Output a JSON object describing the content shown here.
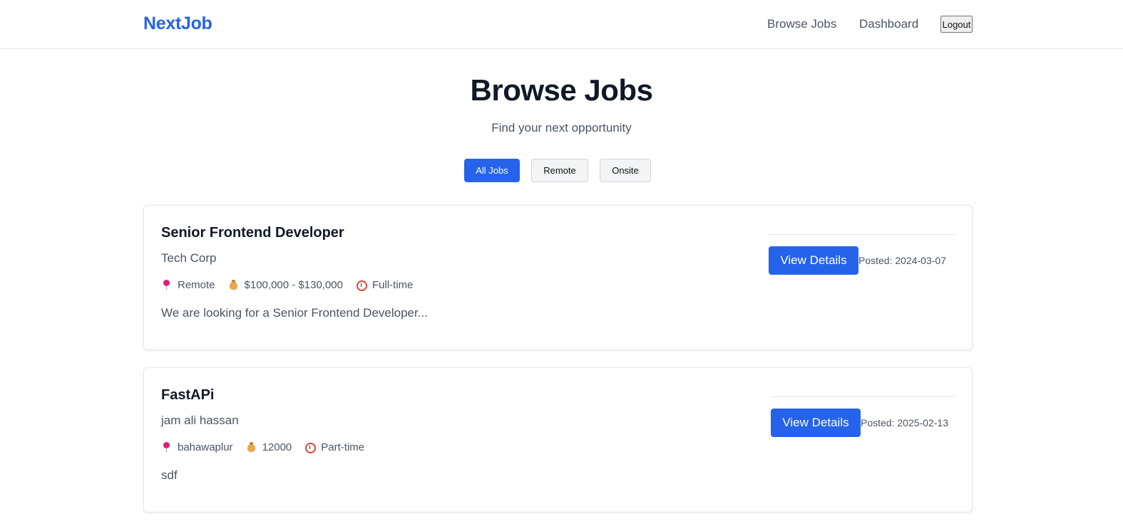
{
  "navbar": {
    "brand": "NextJob",
    "links": [
      "Browse Jobs",
      "Dashboard"
    ],
    "logout_label": "Logout"
  },
  "header": {
    "title": "Browse Jobs",
    "subtitle": "Find your next opportunity"
  },
  "filters": {
    "options": [
      "All Jobs",
      "Remote",
      "Onsite"
    ],
    "active": "All Jobs"
  },
  "jobs": [
    {
      "title": "Senior Frontend Developer",
      "company": "Tech Corp",
      "location": "Remote",
      "salary": "$100,000 - $130,000",
      "type": "Full-time",
      "description": "We are looking for a Senior Frontend Developer...",
      "button_label": "View Details",
      "posted": "Posted: 2024-03-07"
    },
    {
      "title": "FastAPi",
      "company": "jam ali hassan",
      "location": "bahawaplur",
      "salary": "12000",
      "type": "Part-time",
      "description": "sdf",
      "button_label": "View Details",
      "posted": "Posted: 2025-02-13"
    }
  ],
  "icons": {
    "location": "pin-icon",
    "salary": "money-bag-icon",
    "type": "alarm-clock-icon"
  },
  "colors": {
    "accent": "#2563eb",
    "text_primary": "#111827",
    "text_secondary": "#4b5563",
    "border": "#e5e7eb"
  }
}
